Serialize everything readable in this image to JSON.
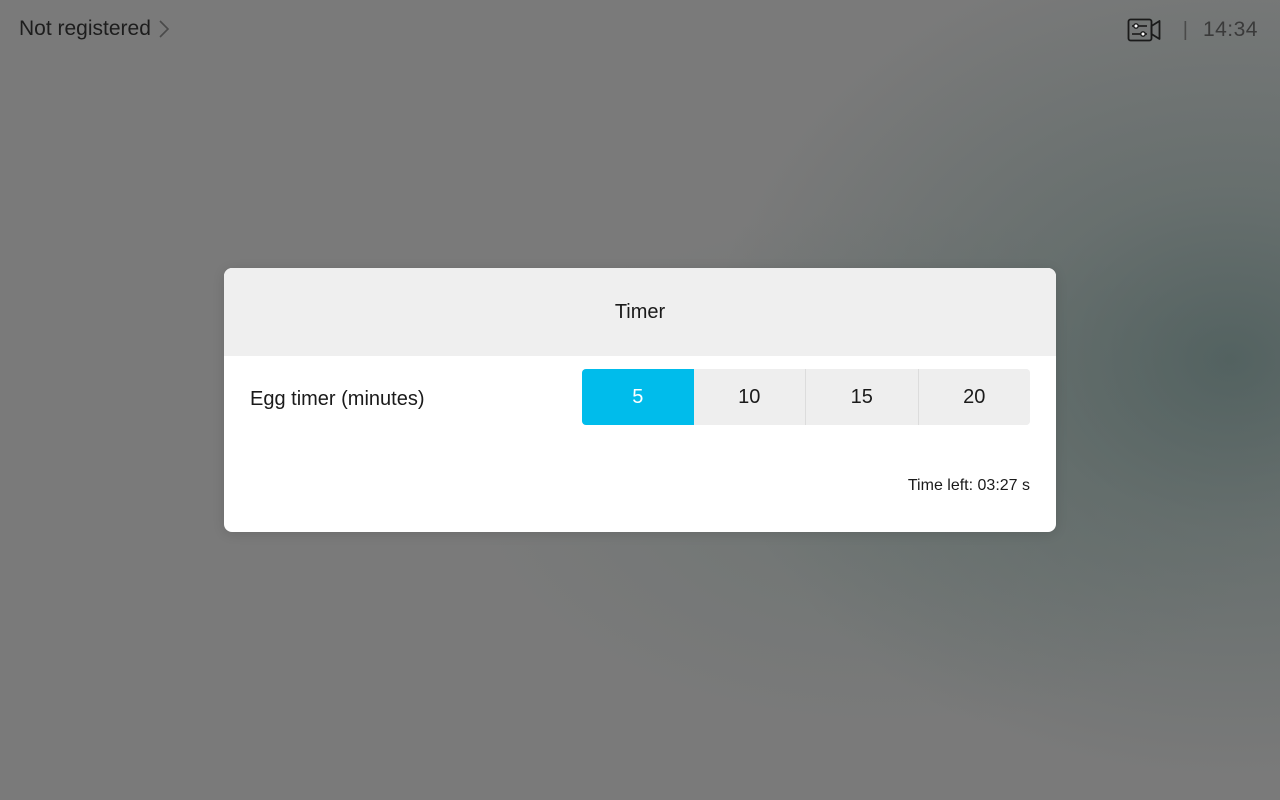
{
  "status_bar": {
    "registration": "Not registered",
    "registration_icon": "chevron-right-icon",
    "camera_icon": "camera-controls-icon",
    "separator": "|",
    "clock": "14:34"
  },
  "dialog": {
    "title": "Timer",
    "row_label": "Egg timer (minutes)",
    "options": [
      "5",
      "10",
      "15",
      "20"
    ],
    "selected_option": "5",
    "time_left": "Time left: 03:27 s"
  },
  "colors": {
    "accent": "#00bceb",
    "background": "#7a7a7a",
    "dialog_header": "#efefef"
  }
}
